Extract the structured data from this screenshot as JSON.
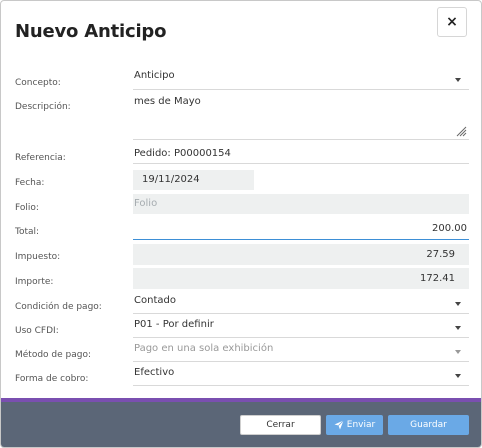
{
  "dialog": {
    "title": "Nuevo Anticipo",
    "close_label": "×"
  },
  "form": {
    "concepto": {
      "label": "Concepto:",
      "value": "Anticipo"
    },
    "descripcion": {
      "label": "Descripción:",
      "value": "mes de Mayo"
    },
    "referencia": {
      "label": "Referencia:",
      "value": "Pedido: P00000154"
    },
    "fecha": {
      "label": "Fecha:",
      "value": "19/11/2024"
    },
    "folio": {
      "label": "Folio:",
      "placeholder": "Folio"
    },
    "total": {
      "label": "Total:",
      "value": "200.00"
    },
    "impuesto": {
      "label": "Impuesto:",
      "value": "27.59"
    },
    "importe": {
      "label": "Importe:",
      "value": "172.41"
    },
    "condicion_pago": {
      "label": "Condición de pago:",
      "value": "Contado"
    },
    "uso_cfdi": {
      "label": "Uso CFDI:",
      "value": "P01 - Por definir"
    },
    "metodo_pago": {
      "label": "Método de pago:",
      "value": "Pago en una sola exhibición"
    },
    "forma_cobro": {
      "label": "Forma de cobro:",
      "value": "Efectivo"
    }
  },
  "footer": {
    "cerrar_label": "Cerrar",
    "enviar_label": "Enviar",
    "guardar_label": "Guardar"
  },
  "colors": {
    "primary_button": "#6aa9e6",
    "footer_bg": "#5b6677",
    "accent_bar": "#7a4fb0",
    "active_input_border": "#3d8fd6"
  },
  "icons": {
    "send": "paper-plane-icon",
    "close": "close-icon",
    "dropdown": "chevron-down-icon",
    "resize": "resize-handle-icon"
  }
}
